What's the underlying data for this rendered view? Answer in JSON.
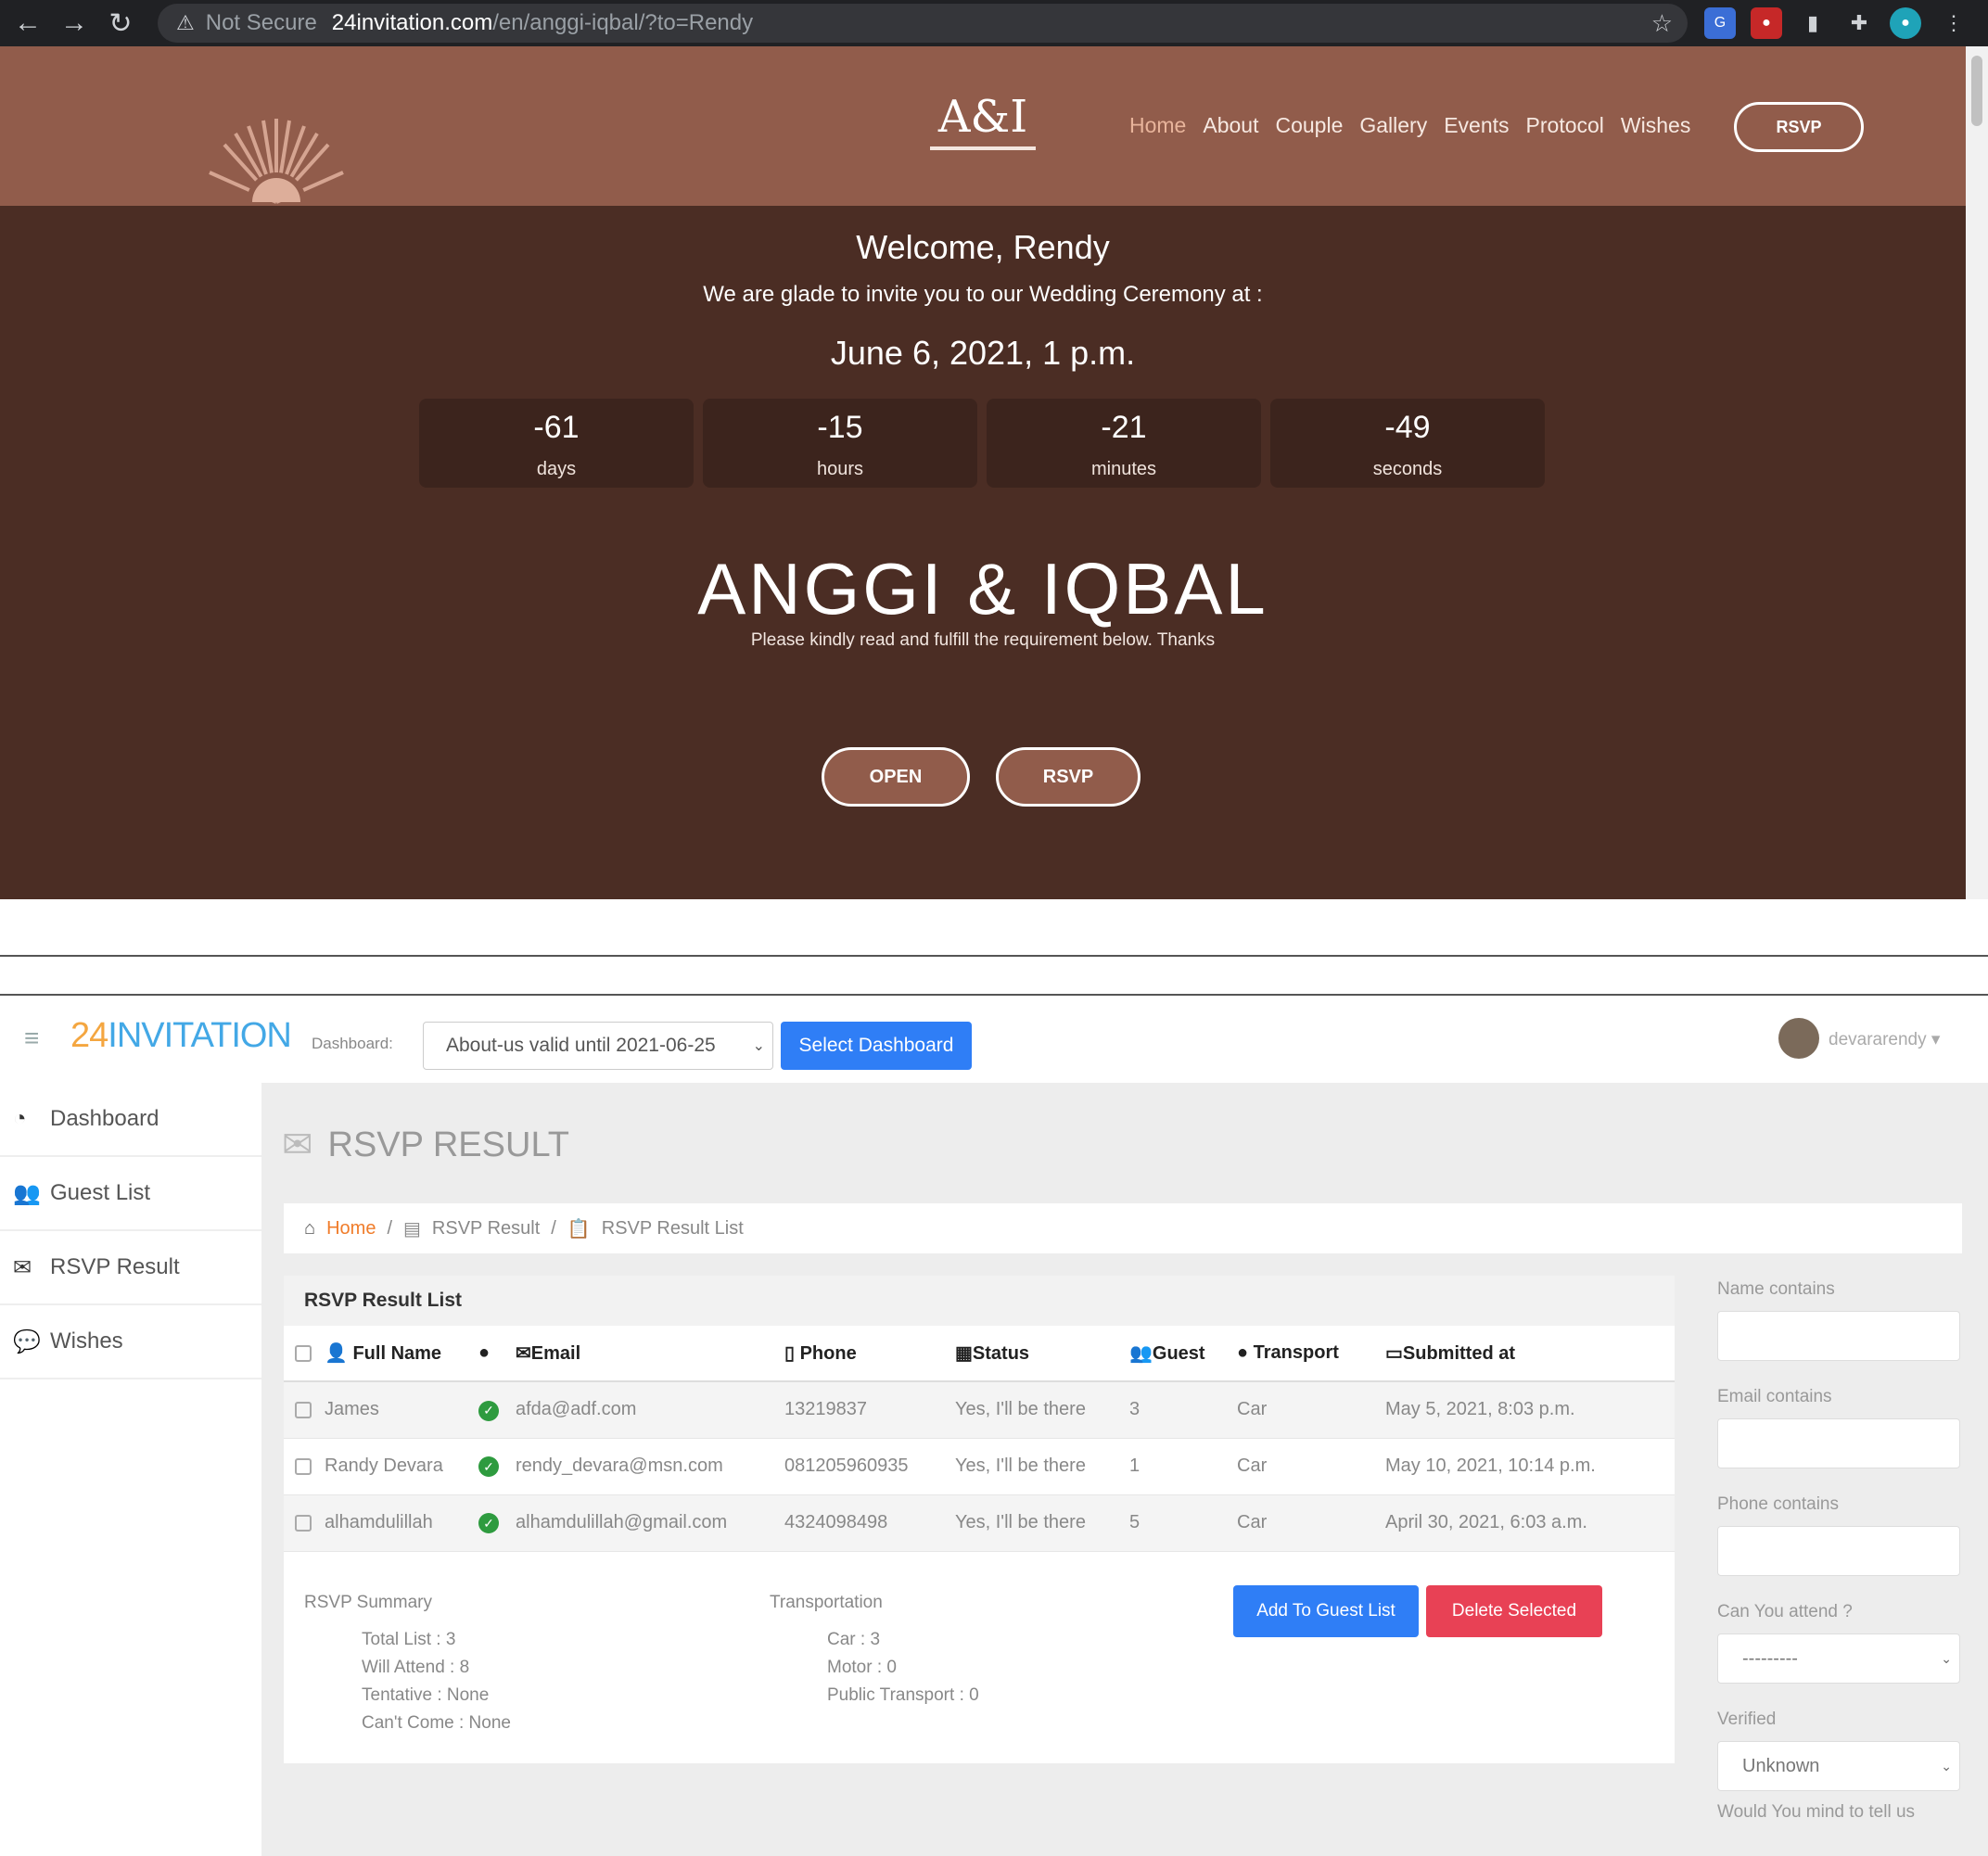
{
  "browser": {
    "security_icon": "warning-triangle-icon",
    "security_label": "Not Secure",
    "url_host": "24invitation.com",
    "url_path": "/en/anggi-iqbal/?to=Rendy"
  },
  "site": {
    "nav": {
      "monogram": "A&I",
      "links": [
        "Home",
        "About",
        "Couple",
        "Gallery",
        "Events",
        "Protocol",
        "Wishes"
      ],
      "rsvp_label": "RSVP"
    },
    "welcome": "Welcome, Rendy",
    "invite_text": "We are glade to invite you to our Wedding Ceremony at :",
    "event_date": "June 6, 2021, 1 p.m.",
    "countdown": [
      {
        "value": "-61",
        "unit": "days"
      },
      {
        "value": "-15",
        "unit": "hours"
      },
      {
        "value": "-21",
        "unit": "minutes"
      },
      {
        "value": "-49",
        "unit": "seconds"
      }
    ],
    "couple_names": "ANGGI & IQBAL",
    "note": "Please kindly read and fulfill the requirement below. Thanks",
    "open_label": "OPEN",
    "rsvp_button_label": "RSVP"
  },
  "dashboard": {
    "brand_num": "24",
    "brand_text": "INVITATION",
    "dashboard_label": "Dashboard:",
    "dashboard_select": "About-us valid until 2021-06-25",
    "select_dashboard_label": "Select Dashboard",
    "user_name": "devararendy",
    "sidebar": [
      {
        "icon": "dashboard-icon",
        "label": "Dashboard"
      },
      {
        "icon": "users-icon",
        "label": "Guest List"
      },
      {
        "icon": "envelope-icon",
        "label": "RSVP Result"
      },
      {
        "icon": "comments-icon",
        "label": "Wishes"
      }
    ],
    "page_title": "RSVP RESULT",
    "breadcrumb": [
      "Home",
      "RSVP Result",
      "RSVP Result List"
    ],
    "panel_title": "RSVP Result List",
    "columns": [
      "Full Name",
      "",
      "Email",
      "Phone",
      "Status",
      "Guest",
      "Transport",
      "Submitted at"
    ],
    "rows": [
      {
        "name": "James",
        "email": "afda@adf.com",
        "phone": "13219837",
        "status": "Yes, I'll be there",
        "guest": "3",
        "transport": "Car",
        "submitted": "May 5, 2021, 8:03 p.m."
      },
      {
        "name": "Randy Devara",
        "email": "rendy_devara@msn.com",
        "phone": "081205960935",
        "status": "Yes, I'll be there",
        "guest": "1",
        "transport": "Car",
        "submitted": "May 10, 2021, 10:14 p.m."
      },
      {
        "name": "alhamdulillah",
        "email": "alhamdulillah@gmail.com",
        "phone": "4324098498",
        "status": "Yes, I'll be there",
        "guest": "5",
        "transport": "Car",
        "submitted": "April 30, 2021, 6:03 a.m."
      }
    ],
    "summary": {
      "title": "RSVP Summary",
      "lines": [
        "Total List : 3",
        "Will Attend : 8",
        "Tentative : None",
        "Can't Come : None"
      ]
    },
    "transportation": {
      "title": "Transportation",
      "lines": [
        "Car : 3",
        "Motor : 0",
        "Public Transport : 0"
      ]
    },
    "add_to_guest_label": "Add To Guest List",
    "delete_selected_label": "Delete Selected",
    "filters": {
      "name_label": "Name contains",
      "email_label": "Email contains",
      "phone_label": "Phone contains",
      "attend_label": "Can You attend ?",
      "attend_value": "---------",
      "verified_label": "Verified",
      "verified_value": "Unknown",
      "more_label": "Would You mind to tell us"
    }
  },
  "colors": {
    "site_bg": "#4b2d24",
    "site_nav": "#915c4b",
    "primary_blue": "#2f7ef6",
    "danger_red": "#e84155",
    "verified_green": "#2e9b3f",
    "brand_orange": "#f4a640",
    "brand_blue": "#43a8e6"
  }
}
